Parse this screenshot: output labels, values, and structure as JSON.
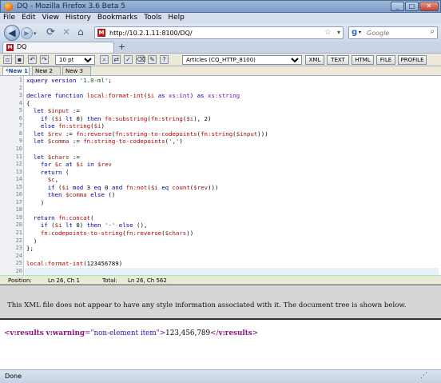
{
  "window": {
    "title": "DQ - Mozilla Firefox 3.6 Beta 5"
  },
  "menu": [
    "File",
    "Edit",
    "View",
    "History",
    "Bookmarks",
    "Tools",
    "Help"
  ],
  "nav": {
    "url": "http://10.2.1.11:8100/DQ/",
    "search_placeholder": "Google"
  },
  "tab": {
    "label": "DQ"
  },
  "toolbar": {
    "font_size": "10 pt",
    "collection": "Articles (CQ_HTTP_8100)",
    "buttons": [
      "XML",
      "TEXT",
      "HTML",
      "FILE",
      "PROFILE"
    ]
  },
  "doc_tabs": [
    "*New 1",
    "New 2",
    "New 3"
  ],
  "code": [
    "xquery version '1.0-ml';",
    "",
    "declare function local:format-int($i as xs:int) as xs:string",
    "{",
    "  let $input :=",
    "    if ($i lt 0) then fn:substring(fn:string($i), 2)",
    "    else fn:string($i)",
    "  let $rev := fn:reverse(fn:string-to-codepoints(fn:string($input)))",
    "  let $comma := fn:string-to-codepoints(',')",
    "",
    "  let $chars :=",
    "    for $c at $i in $rev",
    "    return (",
    "      $c,",
    "      if ($i mod 3 eq 0 and fn:not($i eq count($rev)))",
    "      then $comma else ()",
    "    )",
    "",
    "  return fn:concat(",
    "    if ($i lt 0) then '-' else (),",
    "    fn:codepoints-to-string(fn:reverse($chars))",
    "  )",
    "};",
    "",
    "local:format-int(123456789)",
    ""
  ],
  "status": {
    "position_label": "Position:",
    "position": "Ln 26, Ch 1",
    "total_label": "Total:",
    "total": "Ln 26, Ch 562"
  },
  "info": {
    "message": "This XML file does not appear to have any style information associated with it. The document tree is shown below."
  },
  "result": {
    "open_tag": "v:results",
    "attr_name": "v:warning",
    "attr_value": "non-element item",
    "text": "123,456,789",
    "close_tag": "v:results"
  },
  "browser_status": {
    "text": "Done"
  }
}
